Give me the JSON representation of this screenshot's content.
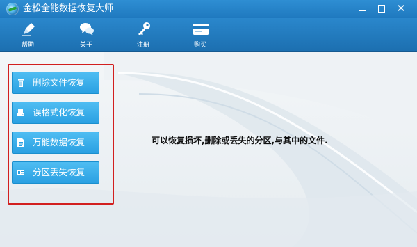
{
  "window": {
    "title": "金松全能数据恢复大师"
  },
  "toolbar": {
    "items": [
      {
        "label": "帮助",
        "icon": "pen-icon"
      },
      {
        "label": "关于",
        "icon": "chat-bubbles-icon"
      },
      {
        "label": "注册",
        "icon": "key-icon"
      },
      {
        "label": "购买",
        "icon": "credit-card-icon"
      }
    ]
  },
  "sidebar": {
    "buttons": [
      {
        "label": "删除文件恢复",
        "icon": "trash-icon"
      },
      {
        "label": "误格式化恢复",
        "icon": "drive-icon"
      },
      {
        "label": "万能数据恢复",
        "icon": "document-icon"
      },
      {
        "label": "分区丢失恢复",
        "icon": "partition-icon"
      }
    ]
  },
  "main": {
    "description": "可以恢复损坏,删除或丢失的分区,与其中的文件."
  },
  "colors": {
    "titlebar": "#1f79bf",
    "button": "#2aa0e2",
    "highlight": "#d21f1f"
  }
}
